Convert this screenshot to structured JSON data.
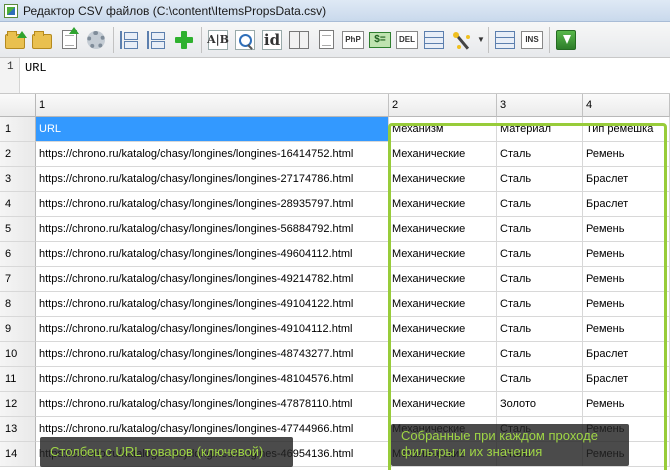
{
  "window": {
    "title": "Редактор CSV файлов (C:\\content\\ItemsPropsData.csv)"
  },
  "toolbar": {
    "icons": [
      "open-folder-icon",
      "save-folder-icon",
      "new-file-icon",
      "settings-gear-icon",
      "tree-view-icon",
      "split-icon",
      "add-icon",
      "spellcheck-icon",
      "find-icon",
      "id-icon",
      "columns-icon",
      "page-icon",
      "php-icon",
      "currency-icon",
      "delete-icon",
      "columns-grid-icon",
      "magic-wand-icon",
      "dropdown-icon",
      "table-icon",
      "table-ins-icon",
      "export-icon"
    ],
    "labels": {
      "text": "A|B",
      "id": "id",
      "php": "PhP",
      "money": "$=",
      "del": "DEL",
      "ins": "INS"
    }
  },
  "editor": {
    "line": "1",
    "value": "URL"
  },
  "grid": {
    "columns": [
      "",
      "1",
      "2",
      "3",
      "4"
    ],
    "rows": [
      [
        "1",
        "URL",
        "Механизм",
        "Материал",
        "Тип ремешка"
      ],
      [
        "2",
        "https://chrono.ru/katalog/chasy/longines/longines-16414752.html",
        "Механические",
        "Сталь",
        "Ремень"
      ],
      [
        "3",
        "https://chrono.ru/katalog/chasy/longines/longines-27174786.html",
        "Механические",
        "Сталь",
        "Браслет"
      ],
      [
        "4",
        "https://chrono.ru/katalog/chasy/longines/longines-28935797.html",
        "Механические",
        "Сталь",
        "Браслет"
      ],
      [
        "5",
        "https://chrono.ru/katalog/chasy/longines/longines-56884792.html",
        "Механические",
        "Сталь",
        "Ремень"
      ],
      [
        "6",
        "https://chrono.ru/katalog/chasy/longines/longines-49604112.html",
        "Механические",
        "Сталь",
        "Ремень"
      ],
      [
        "7",
        "https://chrono.ru/katalog/chasy/longines/longines-49214782.html",
        "Механические",
        "Сталь",
        "Ремень"
      ],
      [
        "8",
        "https://chrono.ru/katalog/chasy/longines/longines-49104122.html",
        "Механические",
        "Сталь",
        "Ремень"
      ],
      [
        "9",
        "https://chrono.ru/katalog/chasy/longines/longines-49104112.html",
        "Механические",
        "Сталь",
        "Ремень"
      ],
      [
        "10",
        "https://chrono.ru/katalog/chasy/longines/longines-48743277.html",
        "Механические",
        "Сталь",
        "Браслет"
      ],
      [
        "11",
        "https://chrono.ru/katalog/chasy/longines/longines-48104576.html",
        "Механические",
        "Сталь",
        "Браслет"
      ],
      [
        "12",
        "https://chrono.ru/katalog/chasy/longines/longines-47878110.html",
        "Механические",
        "Золото",
        "Ремень"
      ],
      [
        "13",
        "https://chrono.ru/katalog/chasy/longines/longines-47744966.html",
        "Механические",
        "Сталь",
        "Ремень"
      ],
      [
        "14",
        "https://chrono.ru/katalog/chasy/longines/longines-46954136.html",
        "Механические",
        "Сталь",
        "Ремень"
      ]
    ]
  },
  "callouts": {
    "left": "Столбец с URL товаров (ключевой)",
    "right_line1": "Собранные при каждом проходе",
    "right_line2": "фильтры и их значения"
  },
  "colors": {
    "selection": "#3399ff",
    "highlight": "#98cc3a",
    "callout_text": "#9fd645"
  }
}
